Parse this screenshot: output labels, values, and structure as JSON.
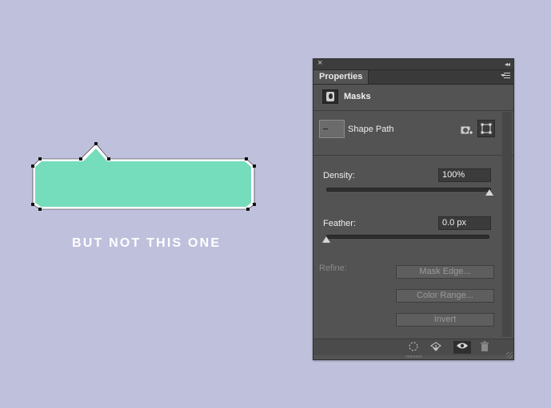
{
  "canvas": {
    "caption": "BUT NOT THIS ONE",
    "shape_fill": "#75dcbc",
    "background": "#bfc0dc"
  },
  "panel": {
    "title_tab": "Properties",
    "masks_label": "Masks",
    "shape_path_label": "Shape Path",
    "density": {
      "label": "Density:",
      "value": "100%",
      "level": 1.0
    },
    "feather": {
      "label": "Feather:",
      "value": "0.0 px",
      "level": 0.0
    },
    "refine_label": "Refine:",
    "buttons": {
      "mask_edge": "Mask Edge...",
      "color_range": "Color Range...",
      "invert": "Invert"
    },
    "icons": {
      "close": "close-icon",
      "collapse": "collapse-icon",
      "panel_menu": "panel-menu-icon",
      "masks": "layer-mask-icon",
      "add_mask": "add-mask-icon",
      "path_select": "path-select-icon",
      "selection": "load-selection-icon",
      "apply": "apply-mask-icon",
      "visibility": "eye-icon",
      "delete": "trash-icon"
    }
  }
}
